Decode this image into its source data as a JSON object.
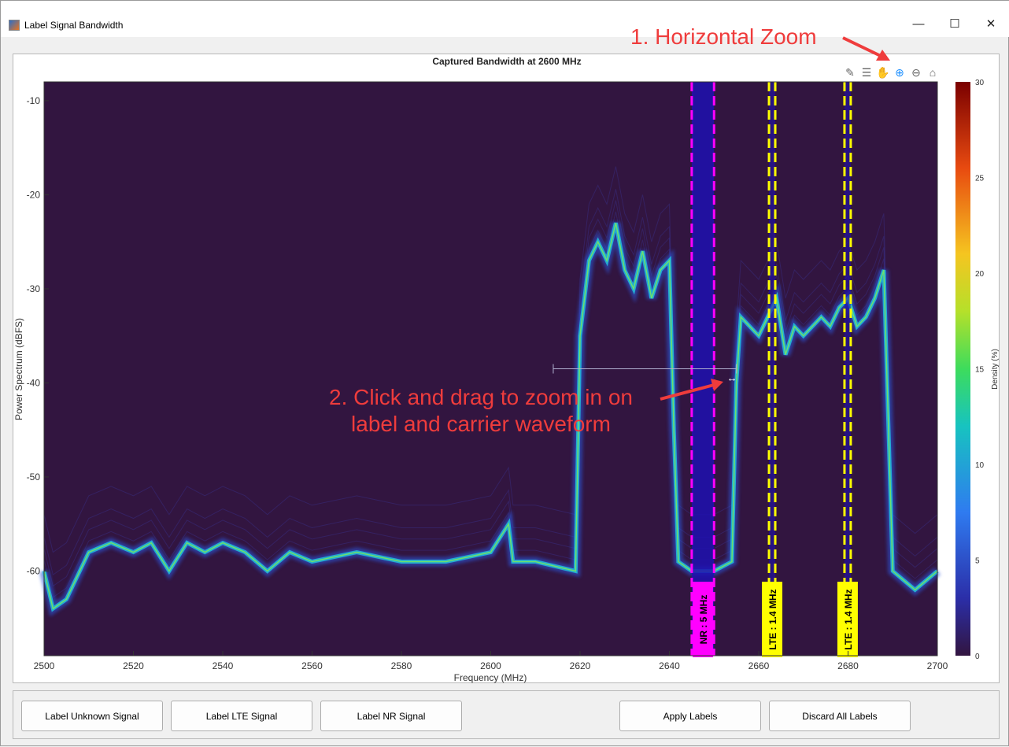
{
  "window": {
    "title": "Label Signal Bandwidth",
    "minimize": "—",
    "maximize": "☐",
    "close": "✕"
  },
  "toolbar": {
    "icons": [
      "brush-icon",
      "legend-icon",
      "pan-icon",
      "zoom-in-icon",
      "zoom-out-icon",
      "home-icon"
    ]
  },
  "annotations": {
    "step1": "1. Horizontal Zoom",
    "step2_line1": "2. Click and drag to zoom in on",
    "step2_line2": "label and carrier waveform",
    "color": "#ef3c3c"
  },
  "chart_data": {
    "type": "heatmap",
    "title": "Captured Bandwidth at 2600 MHz",
    "xlabel": "Frequency (MHz)",
    "ylabel": "Power Spectrum (dBFS)",
    "xlim": [
      2500,
      2700
    ],
    "ylim": [
      -69,
      -8
    ],
    "xticks": [
      2500,
      2520,
      2540,
      2560,
      2580,
      2600,
      2620,
      2640,
      2660,
      2680,
      2700
    ],
    "yticks": [
      -10,
      -20,
      -30,
      -40,
      -50,
      -60
    ],
    "colorbar": {
      "label": "Density (%)",
      "ticks": [
        0,
        5,
        10,
        15,
        20,
        25,
        30
      ],
      "range": [
        0,
        30
      ]
    },
    "trace": [
      [
        2500,
        -60
      ],
      [
        2502,
        -64
      ],
      [
        2505,
        -63
      ],
      [
        2510,
        -58
      ],
      [
        2515,
        -57
      ],
      [
        2520,
        -58
      ],
      [
        2524,
        -57
      ],
      [
        2528,
        -60
      ],
      [
        2532,
        -57
      ],
      [
        2536,
        -58
      ],
      [
        2540,
        -57
      ],
      [
        2545,
        -58
      ],
      [
        2550,
        -60
      ],
      [
        2555,
        -58
      ],
      [
        2560,
        -59
      ],
      [
        2570,
        -58
      ],
      [
        2580,
        -59
      ],
      [
        2590,
        -59
      ],
      [
        2600,
        -58
      ],
      [
        2604,
        -55
      ],
      [
        2605,
        -59
      ],
      [
        2610,
        -59
      ],
      [
        2619,
        -60
      ],
      [
        2620,
        -35
      ],
      [
        2622,
        -27
      ],
      [
        2624,
        -25
      ],
      [
        2626,
        -27
      ],
      [
        2628,
        -23
      ],
      [
        2630,
        -28
      ],
      [
        2632,
        -30
      ],
      [
        2634,
        -26
      ],
      [
        2636,
        -31
      ],
      [
        2638,
        -28
      ],
      [
        2640,
        -27
      ],
      [
        2641,
        -45
      ],
      [
        2642,
        -59
      ],
      [
        2645,
        -60
      ],
      [
        2650,
        -60
      ],
      [
        2654,
        -59
      ],
      [
        2655,
        -40
      ],
      [
        2656,
        -33
      ],
      [
        2658,
        -34
      ],
      [
        2660,
        -35
      ],
      [
        2662,
        -33
      ],
      [
        2664,
        -31
      ],
      [
        2666,
        -37
      ],
      [
        2668,
        -34
      ],
      [
        2670,
        -35
      ],
      [
        2672,
        -34
      ],
      [
        2674,
        -33
      ],
      [
        2676,
        -34
      ],
      [
        2678,
        -32
      ],
      [
        2680,
        -31
      ],
      [
        2682,
        -34
      ],
      [
        2684,
        -33
      ],
      [
        2686,
        -31
      ],
      [
        2688,
        -28
      ],
      [
        2690,
        -60
      ],
      [
        2695,
        -62
      ],
      [
        2700,
        -60
      ]
    ],
    "labels": [
      {
        "text": "NR : 5 MHz",
        "start": 2645,
        "end": 2650,
        "color": "#ff00ff"
      },
      {
        "text": "LTE : 1.4 MHz",
        "start": 2662.3,
        "end": 2663.7,
        "color": "#ffff00"
      },
      {
        "text": "LTE : 1.4 MHz",
        "start": 2679.2,
        "end": 2680.6,
        "color": "#ffff00"
      }
    ],
    "drag_range": [
      2614,
      2655
    ],
    "drag_y": -38.5
  },
  "buttons": {
    "unknown": "Label Unknown Signal",
    "lte": "Label LTE Signal",
    "nr": "Label NR Signal",
    "apply": "Apply Labels",
    "discard": "Discard All Labels"
  }
}
